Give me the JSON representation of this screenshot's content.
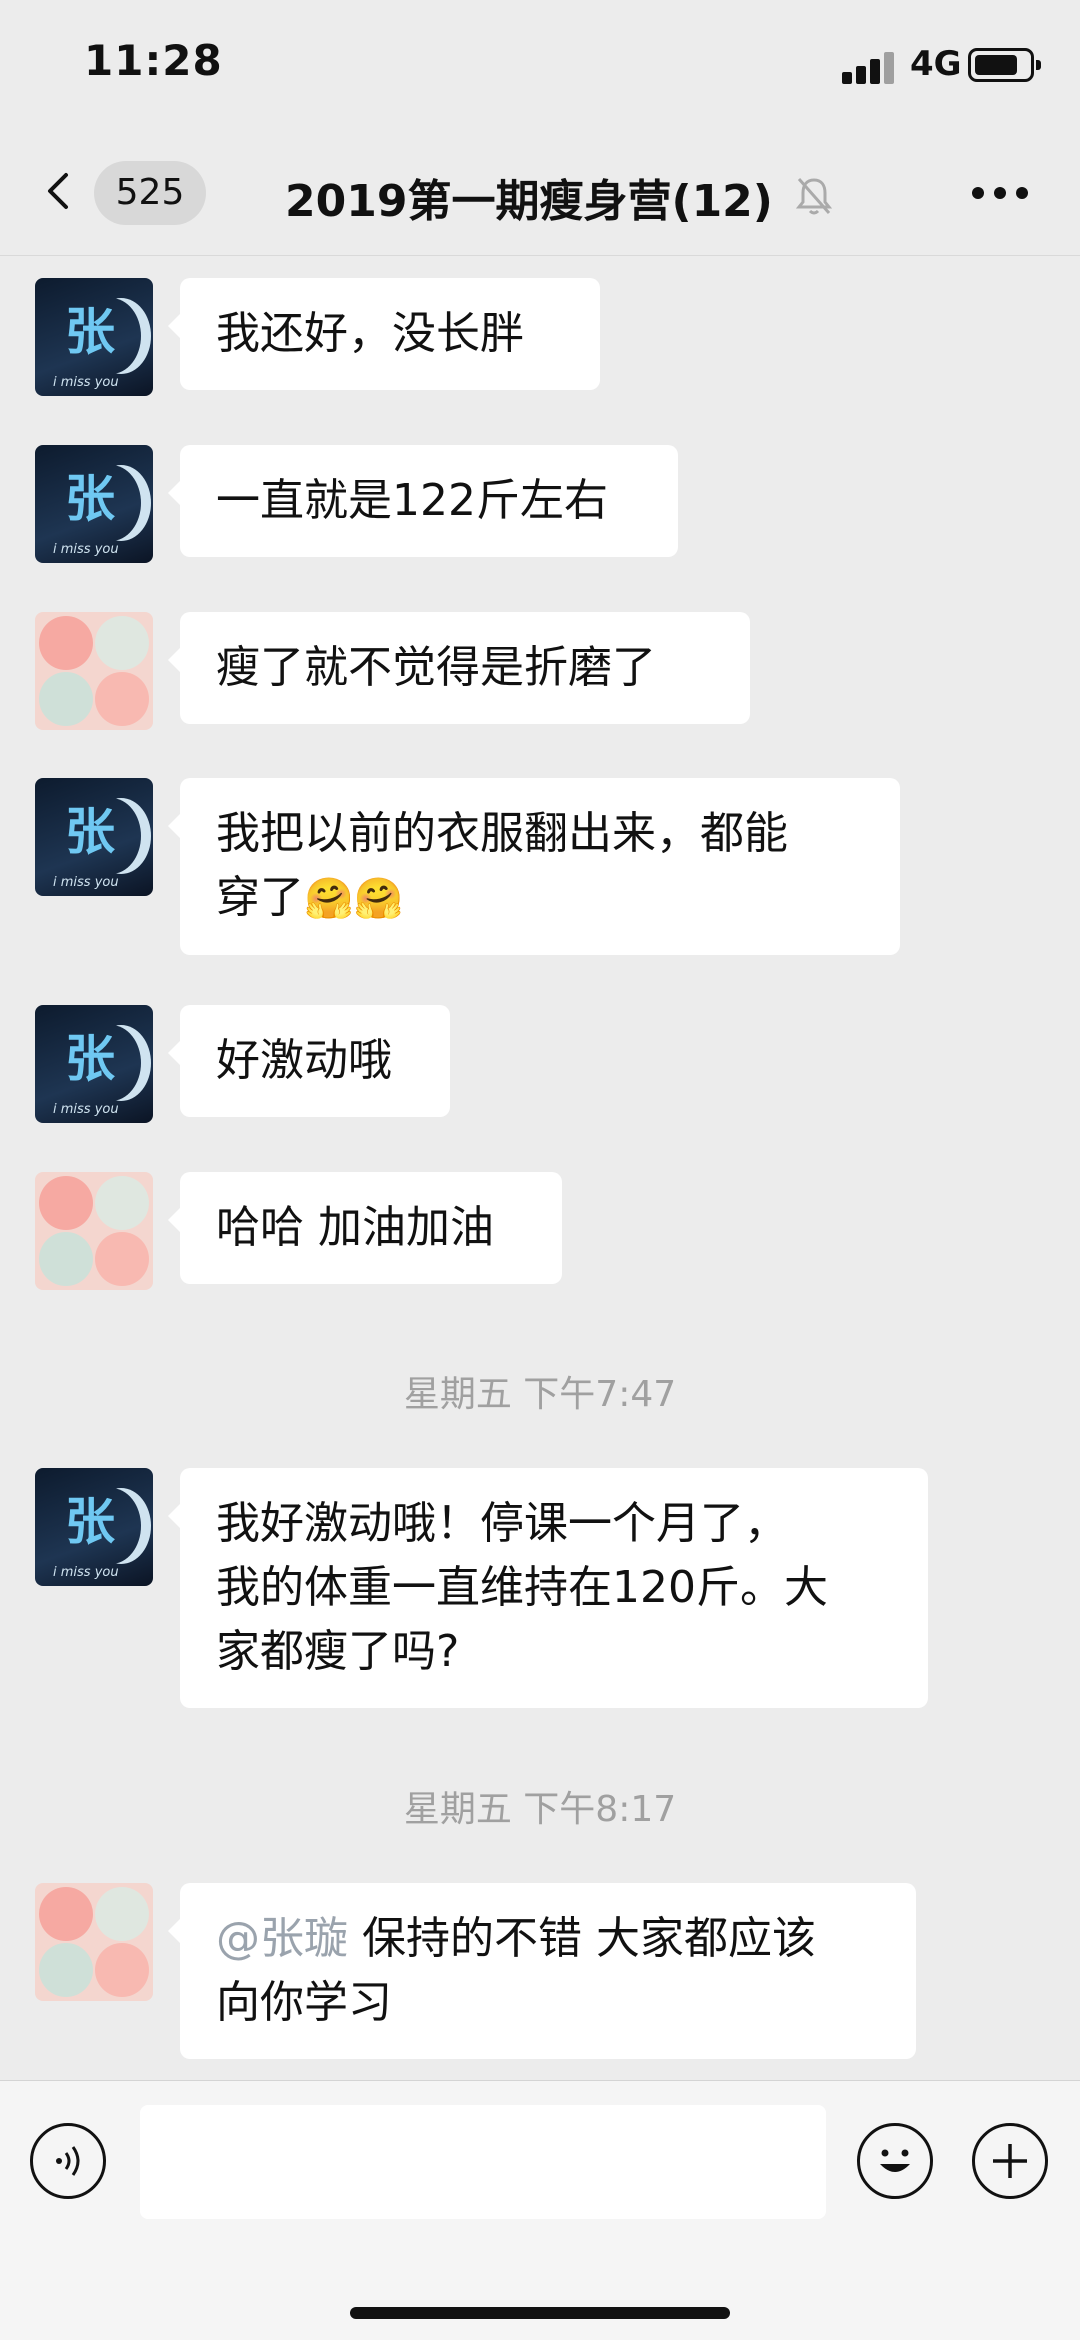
{
  "status_bar": {
    "time": "11:28",
    "network": "4G"
  },
  "nav": {
    "unread_count": "525",
    "title": "2019第一期瘦身营(12)"
  },
  "messages": [
    {
      "text": "我还好，没长胖"
    },
    {
      "text": "一直就是122斤左右"
    },
    {
      "text": "瘦了就不觉得是折磨了"
    },
    {
      "text_line1": "我把以前的衣服翻出来，都能",
      "text_line2": "穿了",
      "emoji": "🤗🤗"
    },
    {
      "text": "好激动哦"
    },
    {
      "text": "哈哈 加油加油"
    },
    {
      "text_line1": "我好激动哦！停课一个月了，",
      "text_line2": "我的体重一直维持在120斤。大",
      "text_line3": "家都瘦了吗?"
    },
    {
      "mention": "@张璇",
      "text_line1": "保持的不错 大家都应该",
      "text_line2": "向你学习"
    }
  ],
  "timestamps": [
    "星期五 下午7:47",
    "星期五 下午8:17"
  ],
  "avatar_caption": "i miss you",
  "avatar_char": "张"
}
